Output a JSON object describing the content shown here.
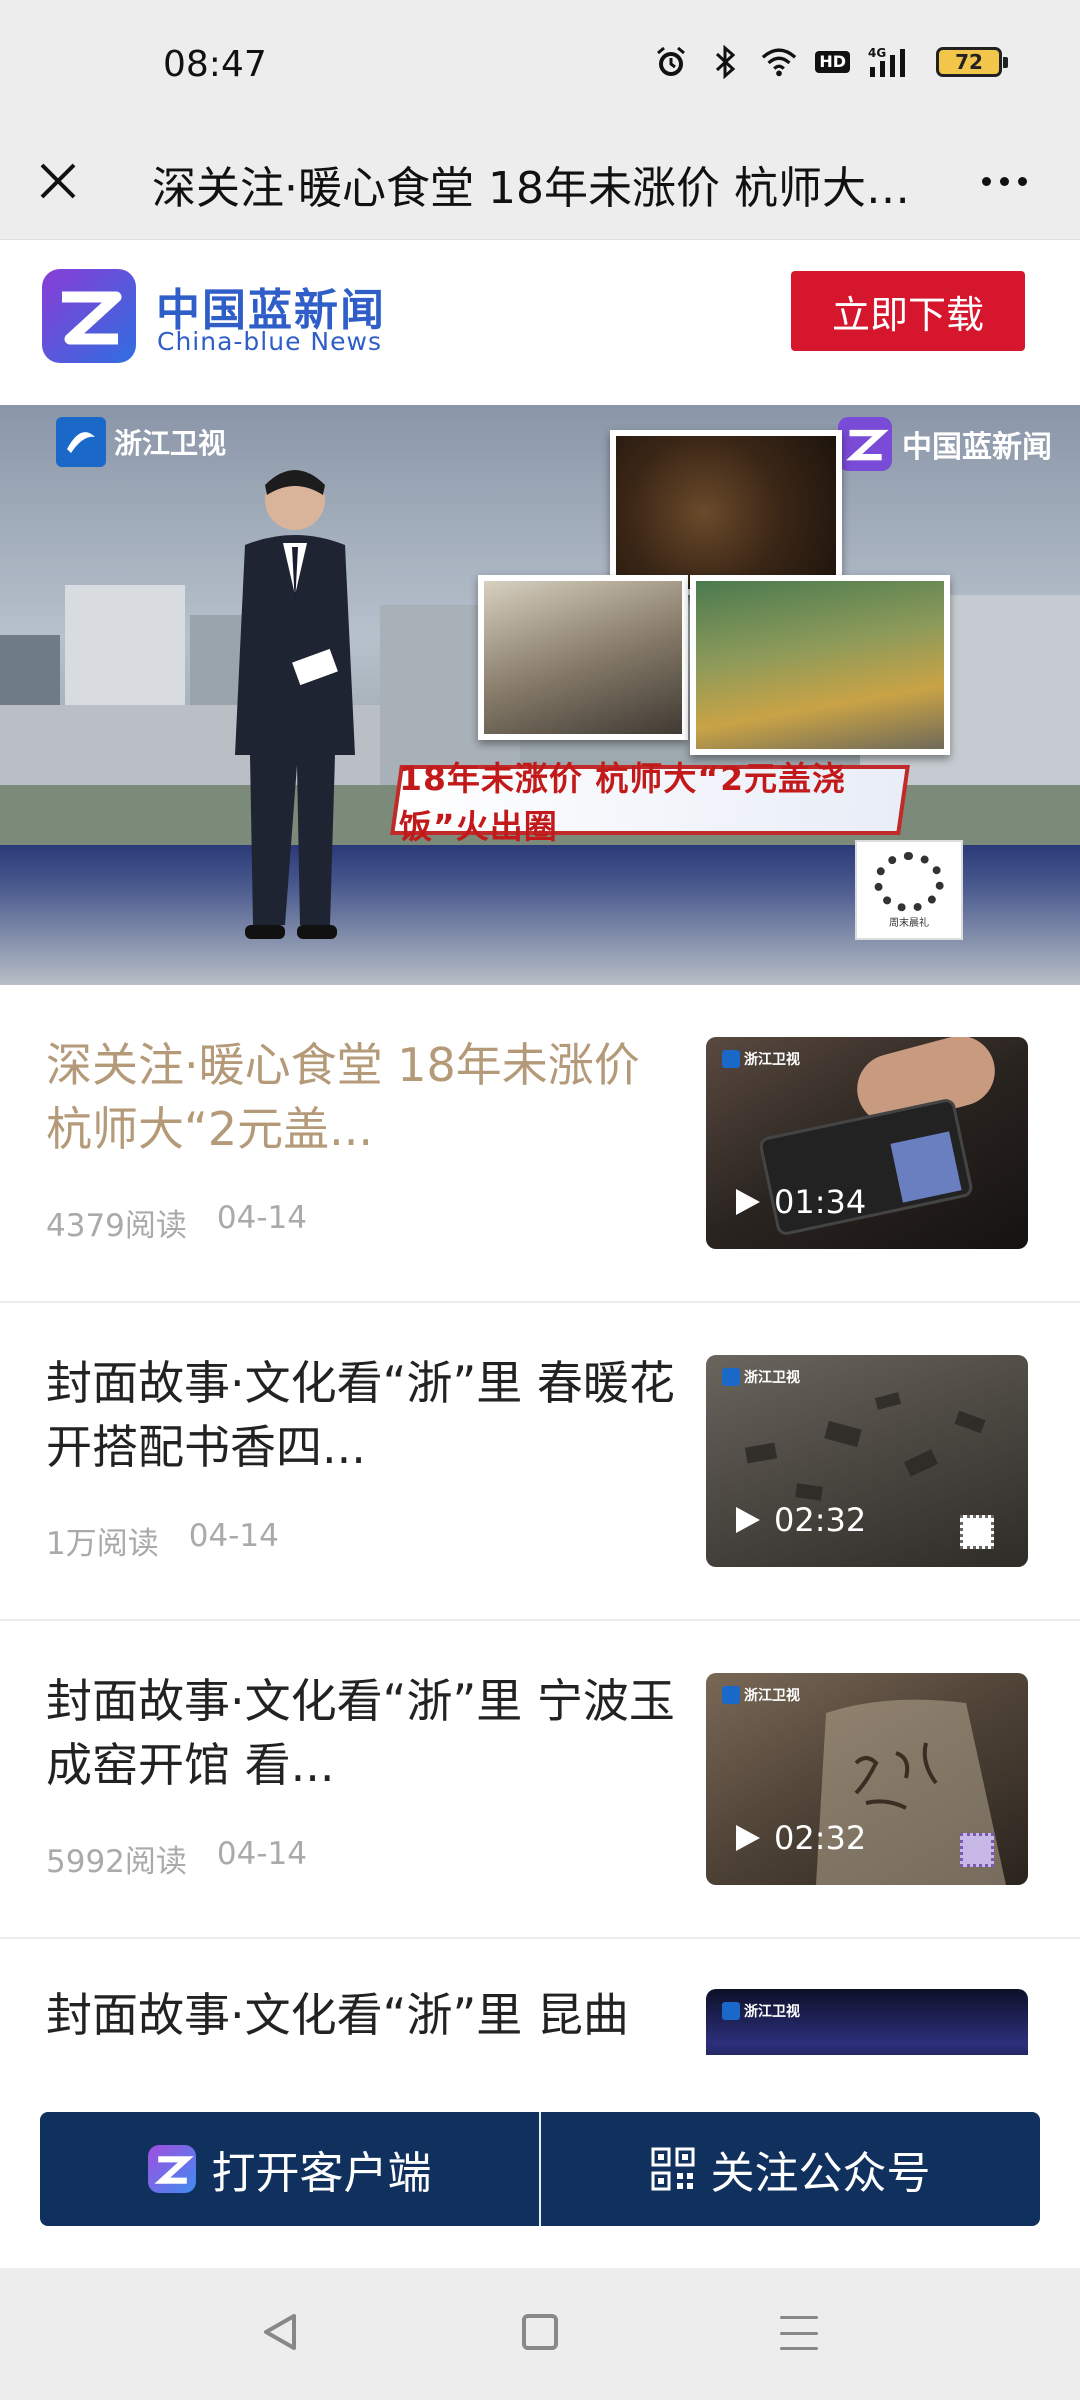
{
  "status_bar": {
    "time": "08:47",
    "hd_label": "HD",
    "network_label": "4G",
    "battery": "72",
    "icons": [
      "alarm-icon",
      "bluetooth-icon",
      "wifi-icon",
      "hd-icon",
      "signal-icon",
      "battery-icon"
    ]
  },
  "title_bar": {
    "title": "深关注·暖心食堂 18年未涨价 杭师大“2元盖浇饭”火出圈",
    "close_icon": "close-icon",
    "more_icon": "more-icon"
  },
  "brand": {
    "name_cn": "中国蓝新闻",
    "name_en": "China-blue News",
    "download_label": "立即下载",
    "accent": "#d6162d",
    "brand_blue": "#2f5ec8"
  },
  "hero": {
    "channel_logo": "浙江卫视",
    "brand_watermark": "中国蓝新闻",
    "banner_text": "18年未涨价  杭师大“2元盖浇饭”火出圈",
    "qr_caption": "周末晨礼"
  },
  "news": [
    {
      "title": "深关注·暖心食堂 18年未涨价 杭师大“2元盖...",
      "reads": "4379阅读",
      "date": "04-14",
      "duration": "01:34",
      "visited": true
    },
    {
      "title": "封面故事·文化看“浙”里 春暖花开搭配书香四...",
      "reads": "1万阅读",
      "date": "04-14",
      "duration": "02:32",
      "visited": false
    },
    {
      "title": "封面故事·文化看“浙”里 宁波玉成窑开馆 看...",
      "reads": "5992阅读",
      "date": "04-14",
      "duration": "02:32",
      "visited": false
    },
    {
      "title": "封面故事·文化看“浙”里 昆曲",
      "reads": "",
      "date": "",
      "duration": "",
      "visited": false
    }
  ],
  "thumb_badge": "浙江卫视",
  "actions": {
    "open_app": "打开客户端",
    "follow": "关注公众号",
    "bar_color": "#10305e"
  }
}
